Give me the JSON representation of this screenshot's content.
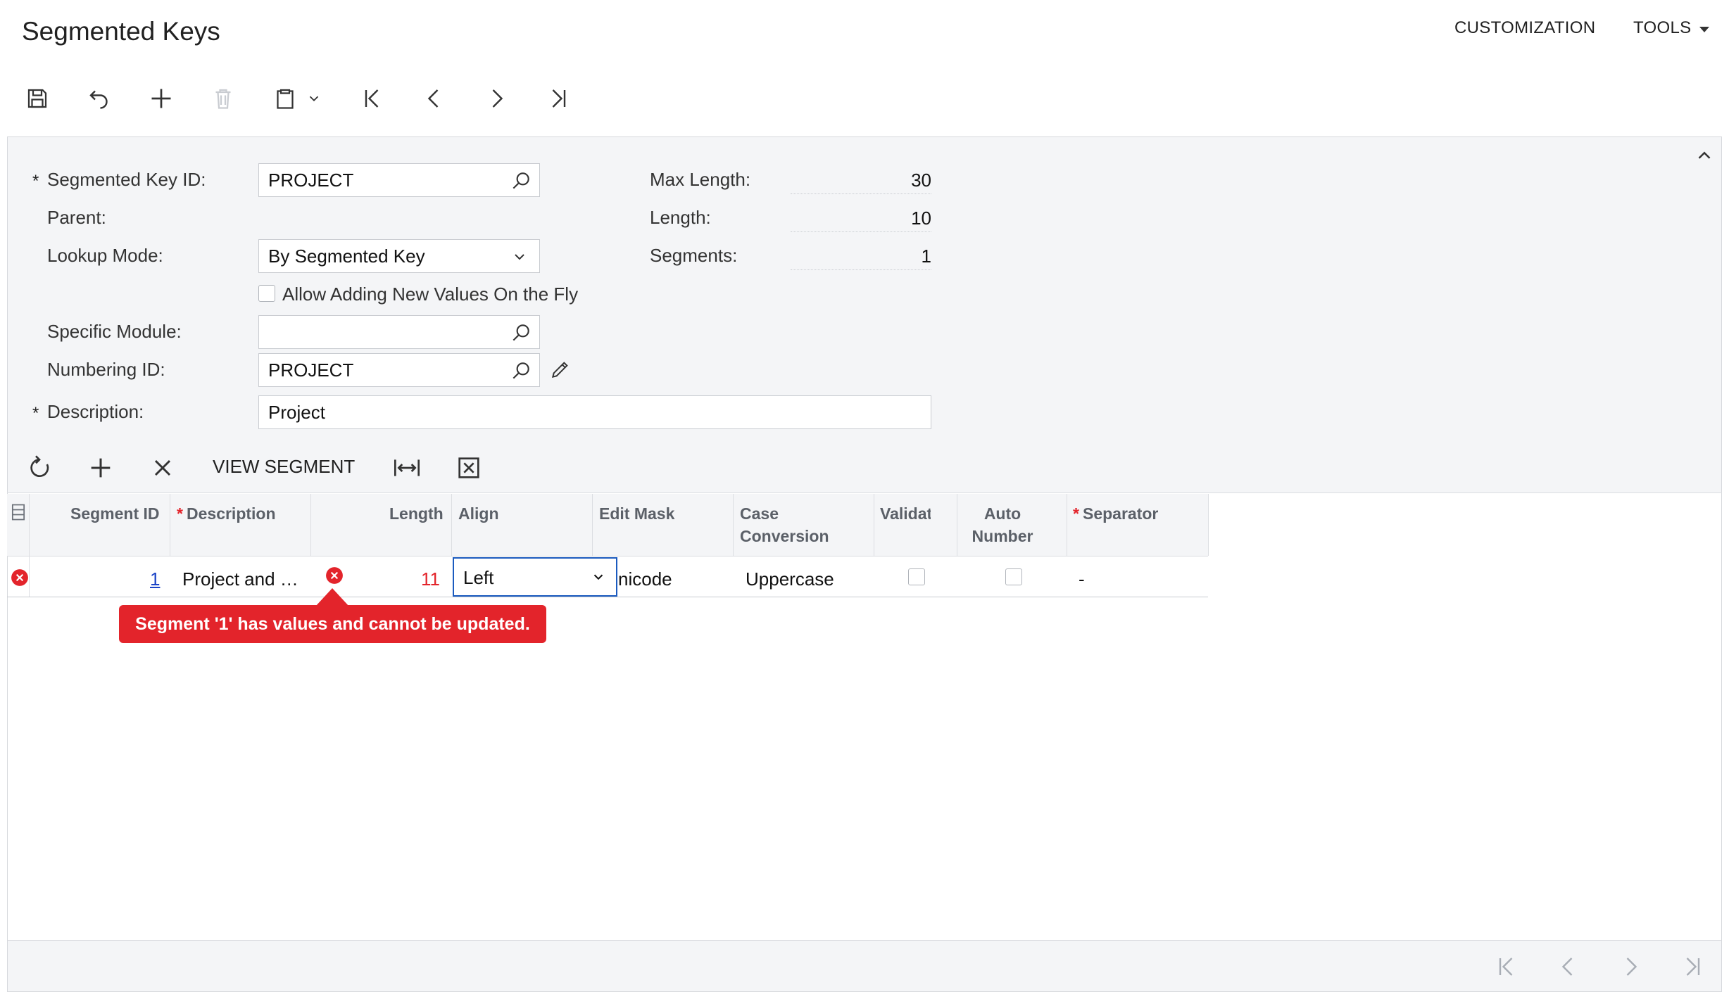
{
  "header": {
    "title": "Segmented Keys",
    "menu": [
      "CUSTOMIZATION",
      "TOOLS"
    ]
  },
  "toolbar": {
    "icons": [
      "save-icon",
      "undo-icon",
      "add-icon",
      "delete-icon",
      "clipboard-icon",
      "first-record-icon",
      "previous-record-icon",
      "next-record-icon",
      "last-record-icon"
    ]
  },
  "form": {
    "segmented_key_id_label": "Segmented Key ID:",
    "segmented_key_id_value": "PROJECT",
    "parent_label": "Parent:",
    "lookup_mode_label": "Lookup Mode:",
    "lookup_mode_value": "By Segmented Key",
    "allow_new_values_label": "Allow Adding New Values On the Fly",
    "allow_new_values_checked": false,
    "specific_module_label": "Specific Module:",
    "specific_module_value": "",
    "numbering_id_label": "Numbering ID:",
    "numbering_id_value": "PROJECT",
    "description_label": "Description:",
    "description_value": "Project",
    "required_marker": "*",
    "max_length_label": "Max Length:",
    "max_length_value": "30",
    "length_label": "Length:",
    "length_value": "10",
    "segments_label": "Segments:",
    "segments_value": "1"
  },
  "grid_toolbar": {
    "view_segment_label": "VIEW SEGMENT",
    "icons": [
      "refresh-icon",
      "add-row-icon",
      "delete-row-icon",
      "fit-columns-icon",
      "export-excel-icon"
    ]
  },
  "grid": {
    "columns": {
      "segment_id": "Segment ID",
      "description": "Description",
      "length": "Length",
      "align": "Align",
      "edit_mask": "Edit Mask",
      "case_conversion_1": "Case",
      "case_conversion_2": "Conversion",
      "validate": "Validat",
      "auto_number_1": "Auto",
      "auto_number_2": "Number",
      "separator": "Separator"
    },
    "rows": [
      {
        "segment_id": "1",
        "description": "Project and …",
        "length": "11",
        "align": "Left",
        "edit_mask": "nicode",
        "case_conversion": "Uppercase",
        "validate": false,
        "auto_number": false,
        "separator": "-"
      }
    ],
    "error_message": "Segment '1' has values and cannot be updated."
  },
  "colors": {
    "error": "#e3242b",
    "link": "#1a43c7",
    "active_border": "#1b5bbf",
    "panel_bg": "#f4f5f7"
  }
}
